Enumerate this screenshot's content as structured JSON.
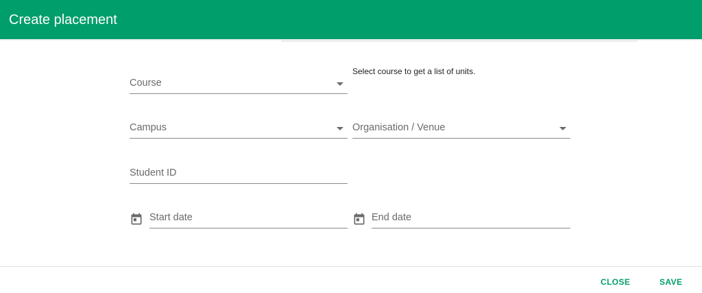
{
  "dialog": {
    "title": "Create placement"
  },
  "form": {
    "course": {
      "label": "Course"
    },
    "course_hint": "Select course to get a list of units.",
    "campus": {
      "label": "Campus"
    },
    "organisation": {
      "label": "Organisation / Venue"
    },
    "student_id": {
      "label": "Student ID"
    },
    "start_date": {
      "label": "Start date"
    },
    "end_date": {
      "label": "End date"
    }
  },
  "actions": {
    "close_label": "CLOSE",
    "save_label": "SAVE"
  },
  "colors": {
    "accent": "#009e6b",
    "header_text": "#ffffff"
  }
}
